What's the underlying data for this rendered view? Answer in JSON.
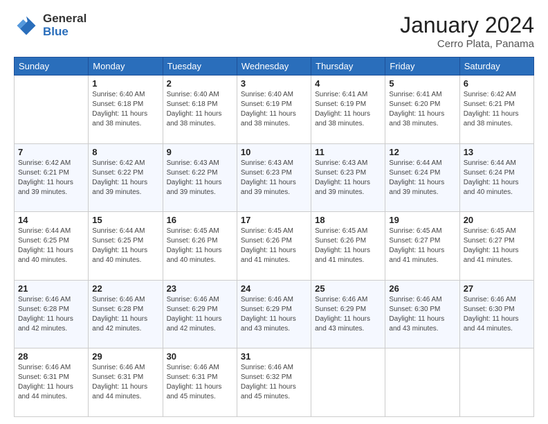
{
  "logo": {
    "general": "General",
    "blue": "Blue"
  },
  "title": "January 2024",
  "subtitle": "Cerro Plata, Panama",
  "weekdays": [
    "Sunday",
    "Monday",
    "Tuesday",
    "Wednesday",
    "Thursday",
    "Friday",
    "Saturday"
  ],
  "weeks": [
    [
      {
        "day": "",
        "info": ""
      },
      {
        "day": "1",
        "info": "Sunrise: 6:40 AM\nSunset: 6:18 PM\nDaylight: 11 hours\nand 38 minutes."
      },
      {
        "day": "2",
        "info": "Sunrise: 6:40 AM\nSunset: 6:18 PM\nDaylight: 11 hours\nand 38 minutes."
      },
      {
        "day": "3",
        "info": "Sunrise: 6:40 AM\nSunset: 6:19 PM\nDaylight: 11 hours\nand 38 minutes."
      },
      {
        "day": "4",
        "info": "Sunrise: 6:41 AM\nSunset: 6:19 PM\nDaylight: 11 hours\nand 38 minutes."
      },
      {
        "day": "5",
        "info": "Sunrise: 6:41 AM\nSunset: 6:20 PM\nDaylight: 11 hours\nand 38 minutes."
      },
      {
        "day": "6",
        "info": "Sunrise: 6:42 AM\nSunset: 6:21 PM\nDaylight: 11 hours\nand 38 minutes."
      }
    ],
    [
      {
        "day": "7",
        "info": "Sunrise: 6:42 AM\nSunset: 6:21 PM\nDaylight: 11 hours\nand 39 minutes."
      },
      {
        "day": "8",
        "info": "Sunrise: 6:42 AM\nSunset: 6:22 PM\nDaylight: 11 hours\nand 39 minutes."
      },
      {
        "day": "9",
        "info": "Sunrise: 6:43 AM\nSunset: 6:22 PM\nDaylight: 11 hours\nand 39 minutes."
      },
      {
        "day": "10",
        "info": "Sunrise: 6:43 AM\nSunset: 6:23 PM\nDaylight: 11 hours\nand 39 minutes."
      },
      {
        "day": "11",
        "info": "Sunrise: 6:43 AM\nSunset: 6:23 PM\nDaylight: 11 hours\nand 39 minutes."
      },
      {
        "day": "12",
        "info": "Sunrise: 6:44 AM\nSunset: 6:24 PM\nDaylight: 11 hours\nand 39 minutes."
      },
      {
        "day": "13",
        "info": "Sunrise: 6:44 AM\nSunset: 6:24 PM\nDaylight: 11 hours\nand 40 minutes."
      }
    ],
    [
      {
        "day": "14",
        "info": "Sunrise: 6:44 AM\nSunset: 6:25 PM\nDaylight: 11 hours\nand 40 minutes."
      },
      {
        "day": "15",
        "info": "Sunrise: 6:44 AM\nSunset: 6:25 PM\nDaylight: 11 hours\nand 40 minutes."
      },
      {
        "day": "16",
        "info": "Sunrise: 6:45 AM\nSunset: 6:26 PM\nDaylight: 11 hours\nand 40 minutes."
      },
      {
        "day": "17",
        "info": "Sunrise: 6:45 AM\nSunset: 6:26 PM\nDaylight: 11 hours\nand 41 minutes."
      },
      {
        "day": "18",
        "info": "Sunrise: 6:45 AM\nSunset: 6:26 PM\nDaylight: 11 hours\nand 41 minutes."
      },
      {
        "day": "19",
        "info": "Sunrise: 6:45 AM\nSunset: 6:27 PM\nDaylight: 11 hours\nand 41 minutes."
      },
      {
        "day": "20",
        "info": "Sunrise: 6:45 AM\nSunset: 6:27 PM\nDaylight: 11 hours\nand 41 minutes."
      }
    ],
    [
      {
        "day": "21",
        "info": "Sunrise: 6:46 AM\nSunset: 6:28 PM\nDaylight: 11 hours\nand 42 minutes."
      },
      {
        "day": "22",
        "info": "Sunrise: 6:46 AM\nSunset: 6:28 PM\nDaylight: 11 hours\nand 42 minutes."
      },
      {
        "day": "23",
        "info": "Sunrise: 6:46 AM\nSunset: 6:29 PM\nDaylight: 11 hours\nand 42 minutes."
      },
      {
        "day": "24",
        "info": "Sunrise: 6:46 AM\nSunset: 6:29 PM\nDaylight: 11 hours\nand 43 minutes."
      },
      {
        "day": "25",
        "info": "Sunrise: 6:46 AM\nSunset: 6:29 PM\nDaylight: 11 hours\nand 43 minutes."
      },
      {
        "day": "26",
        "info": "Sunrise: 6:46 AM\nSunset: 6:30 PM\nDaylight: 11 hours\nand 43 minutes."
      },
      {
        "day": "27",
        "info": "Sunrise: 6:46 AM\nSunset: 6:30 PM\nDaylight: 11 hours\nand 44 minutes."
      }
    ],
    [
      {
        "day": "28",
        "info": "Sunrise: 6:46 AM\nSunset: 6:31 PM\nDaylight: 11 hours\nand 44 minutes."
      },
      {
        "day": "29",
        "info": "Sunrise: 6:46 AM\nSunset: 6:31 PM\nDaylight: 11 hours\nand 44 minutes."
      },
      {
        "day": "30",
        "info": "Sunrise: 6:46 AM\nSunset: 6:31 PM\nDaylight: 11 hours\nand 45 minutes."
      },
      {
        "day": "31",
        "info": "Sunrise: 6:46 AM\nSunset: 6:32 PM\nDaylight: 11 hours\nand 45 minutes."
      },
      {
        "day": "",
        "info": ""
      },
      {
        "day": "",
        "info": ""
      },
      {
        "day": "",
        "info": ""
      }
    ]
  ]
}
